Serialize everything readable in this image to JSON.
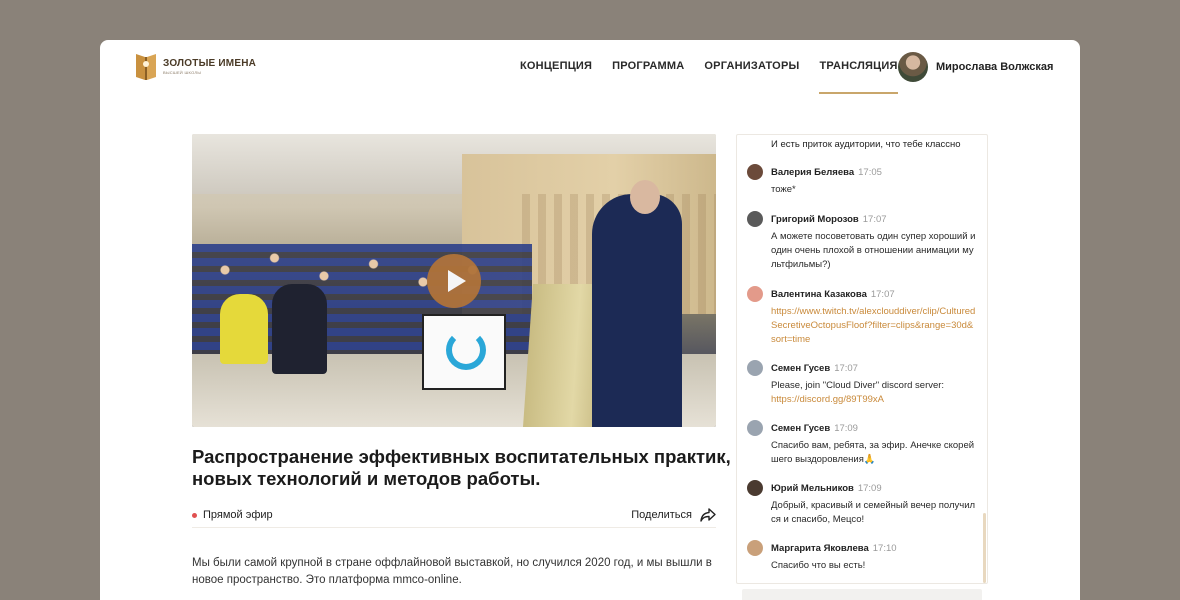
{
  "logo": {
    "title": "ЗОЛОТЫЕ ИМЕНА",
    "subtitle": "ВЫСШЕЙ ШКОЛЫ"
  },
  "nav": {
    "items": [
      {
        "label": "КОНЦЕПЦИЯ",
        "active": false
      },
      {
        "label": "ПРОГРАММА",
        "active": false
      },
      {
        "label": "ОРГАНИЗАТОРЫ",
        "active": false
      },
      {
        "label": "ТРАНСЛЯЦИЯ",
        "active": true
      }
    ],
    "accent": "#c9a66b"
  },
  "user": {
    "name": "Мирослава Волжская"
  },
  "video": {
    "play_icon": "play-icon",
    "play_color": "#b0733a"
  },
  "event": {
    "title": "Распространение эффективных воспитательных практик, новых технологий и методов работы.",
    "live_label": "Прямой эфир",
    "share_label": "Поделиться",
    "description": "Мы были самой крупной в стране оффлайновой выставкой, но случился 2020 год, и мы вышли в новое пространство. Это платформа mmco-online."
  },
  "chat": {
    "first_text": "И есть приток аудитории, что тебе классно",
    "messages": [
      {
        "name": "Валерия Беляева",
        "time": "17:05",
        "text": "тоже*",
        "link": "",
        "avatar": "#6b4a3a"
      },
      {
        "name": "Григорий Морозов",
        "time": "17:07",
        "text": "А можете посоветовать один супер хороший и один очень плохой в отношении анимации мультфильмы?)",
        "link": "",
        "avatar": "#5a5a5a"
      },
      {
        "name": "Валентина Казакова",
        "time": "17:07",
        "text": "",
        "link": "https://www.twitch.tv/alexclouddiver/clip/CulturedSecretiveOctopusFloof?filter=clips&range=30d&sort=time",
        "avatar": "#e39a8a"
      },
      {
        "name": "Семен Гусев",
        "time": "17:07",
        "text": "Please, join \"Cloud Diver\" discord server:",
        "link": "https://discord.gg/89T99xA",
        "avatar": "#9aa4b0"
      },
      {
        "name": "Семен Гусев",
        "time": "17:09",
        "text": "Спасибо вам, ребята, за эфир. Анечке скорейшего выздоровления🙏",
        "link": "",
        "avatar": "#9aa4b0"
      },
      {
        "name": "Юрий Мельников",
        "time": "17:09",
        "text": "Добрый, красивый и семейный вечер получился и спасибо, Мецсо!",
        "link": "",
        "avatar": "#4a3a30"
      },
      {
        "name": "Маргарита Яковлева",
        "time": "17:10",
        "text": "Спасибо что вы есть!",
        "link": "",
        "avatar": "#c9a07a"
      }
    ]
  }
}
